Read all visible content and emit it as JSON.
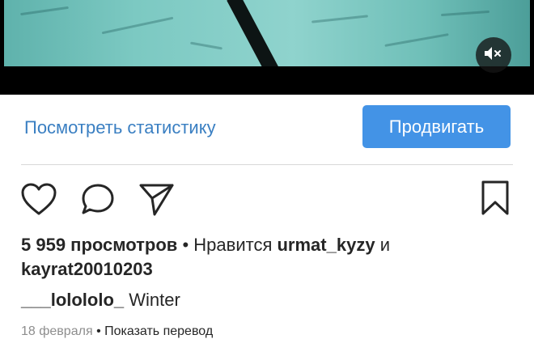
{
  "post": {
    "stats_link": "Посмотреть статистику",
    "promote_button": "Продвигать",
    "views": "5 959 просмотров",
    "likes_separator": "•",
    "likes_prefix": "Нравится",
    "liker_1": "urmat_kyzy",
    "likes_and": "и",
    "liker_2": "kayrat20010203",
    "author": "___lolololo_",
    "caption": "Winter",
    "date": "18 февраля",
    "meta_separator": "•",
    "show_translation": "Показать перевод"
  },
  "icons": {
    "mute": "volume-muted-icon",
    "like": "heart-icon",
    "comment": "comment-bubble-icon",
    "share": "paper-plane-icon",
    "save": "bookmark-icon"
  },
  "colors": {
    "link": "#3a7fc2",
    "button": "#4393e6",
    "text": "#262626",
    "muted": "#8e8e8e"
  }
}
